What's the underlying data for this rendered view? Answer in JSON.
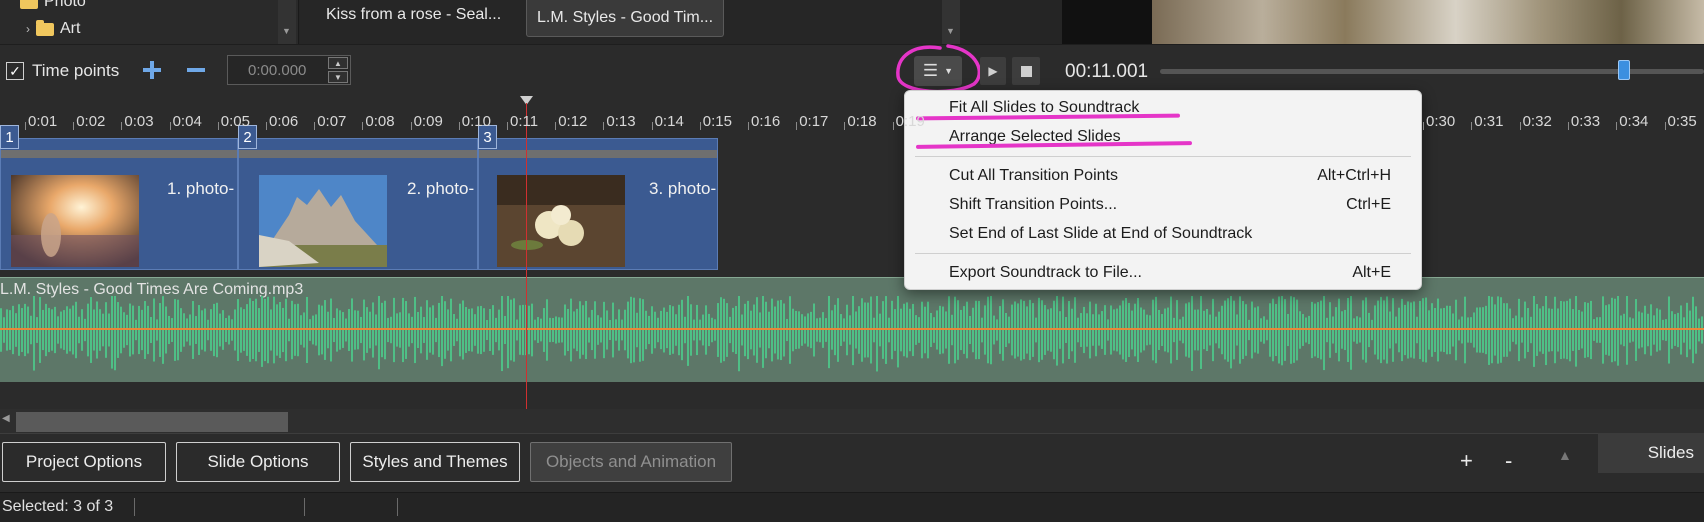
{
  "file_tree": {
    "items": [
      {
        "label": "Photo"
      },
      {
        "label": "Art"
      }
    ]
  },
  "soundtrack_list": {
    "items": [
      {
        "label": "Kiss from a rose - Seal..."
      },
      {
        "label": "L.M. Styles - Good Tim..."
      }
    ]
  },
  "toolbar": {
    "time_points_label": "Time points",
    "time_points_checked": "✓",
    "time_value": "0:00.000",
    "playback_time": "00:11.001",
    "playback_progress_fraction": 0.84
  },
  "ruler": {
    "labels": [
      "0:01",
      "0:02",
      "0:03",
      "0:04",
      "0:05",
      "0:06",
      "0:07",
      "0:08",
      "0:09",
      "0:10",
      "0:11",
      "0:12",
      "0:13",
      "0:14",
      "0:15",
      "0:16",
      "0:17",
      "0:18",
      "0:19",
      "0:30",
      "0:31",
      "0:32",
      "0:33",
      "0:34",
      "0:35"
    ]
  },
  "slides": [
    {
      "number": "1",
      "label": "1. photo-"
    },
    {
      "number": "2",
      "label": "2. photo-"
    },
    {
      "number": "3",
      "label": "3. photo-"
    }
  ],
  "audio": {
    "title": "L.M. Styles - Good Times Are Coming.mp3"
  },
  "context_menu": {
    "items": [
      {
        "label": "Fit All Slides to Soundtrack",
        "shortcut": ""
      },
      {
        "label": "Arrange Selected Slides",
        "shortcut": ""
      },
      {
        "label": "Cut All Transition Points",
        "shortcut": "Alt+Ctrl+H"
      },
      {
        "label": "Shift Transition Points...",
        "shortcut": "Ctrl+E"
      },
      {
        "label": "Set End of Last Slide at End of Soundtrack",
        "shortcut": ""
      },
      {
        "label": "Export Soundtrack to File...",
        "shortcut": "Alt+E"
      }
    ]
  },
  "bottom_buttons": {
    "project_options": "Project Options",
    "slide_options": "Slide Options",
    "styles_and_themes": "Styles and Themes",
    "objects_and_animation": "Objects and Animation",
    "zoom_in": "+",
    "zoom_out": "-",
    "slides_tab": "Slides"
  },
  "status": {
    "selected": "Selected: 3 of 3"
  },
  "colors": {
    "slide_fill": "#3b5a91",
    "waveform": "#4fbf86",
    "playhead": "#d03030",
    "annotation": "#e535c8",
    "progress_thumb": "#3b8fe0"
  }
}
